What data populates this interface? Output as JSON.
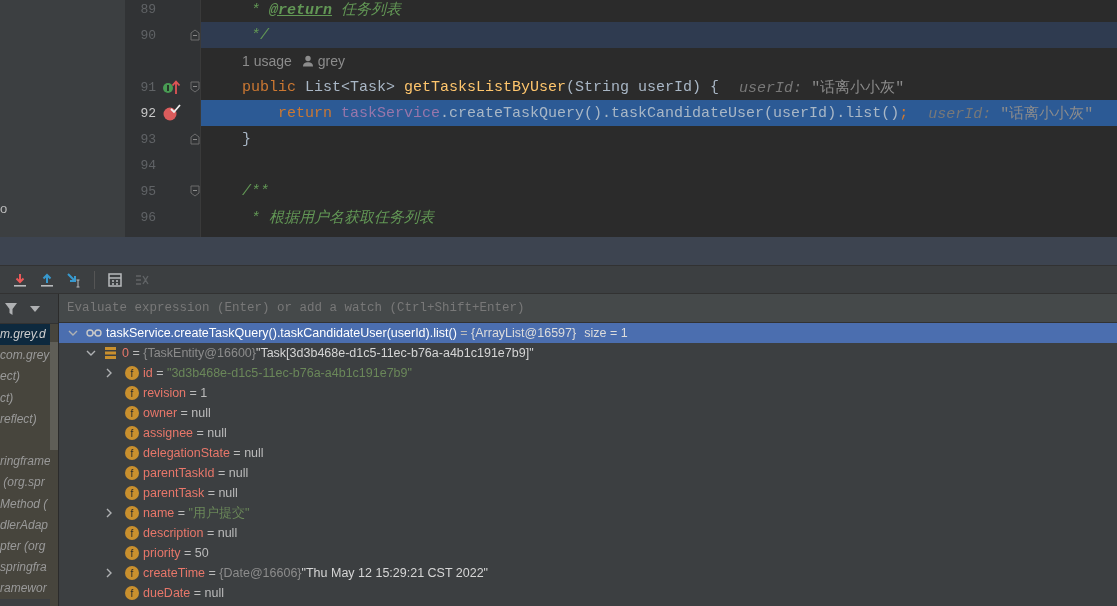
{
  "project_panel": {
    "items": [
      "o"
    ]
  },
  "editor": {
    "lines": [
      {
        "kind": "code",
        "number": "89",
        "tokens": [
          {
            "text": " * ",
            "kind": "comment"
          },
          {
            "text": "@return",
            "kind": "doc_tag"
          },
          {
            "text": " 任务列表",
            "kind": "comment"
          }
        ]
      },
      {
        "kind": "code",
        "number": "90",
        "caret_line": true,
        "fold_end": true,
        "tokens": [
          {
            "text": " */",
            "kind": "comment"
          }
        ]
      },
      {
        "kind": "usage",
        "usages": "1 usage",
        "author": "grey"
      },
      {
        "kind": "code",
        "number": "91",
        "implements_marker": true,
        "fold_start": true,
        "tokens": [
          {
            "text": "public",
            "kind": "keyword"
          },
          {
            "text": " List<Task> ",
            "kind": "plain"
          },
          {
            "text": "getTasksListByUser",
            "kind": "method"
          },
          {
            "text": "(String userId) {",
            "kind": "plain"
          }
        ],
        "hint": {
          "name": "userId:",
          "value": "\"话离小小灰\""
        }
      },
      {
        "kind": "code",
        "number": "92",
        "current": true,
        "execution_point": true,
        "breakpoint": true,
        "tokens": [
          {
            "text": "    return ",
            "kind": "keyword"
          },
          {
            "text": "taskService",
            "kind": "field"
          },
          {
            "text": ".createTaskQuery().taskCandidateUser(userId).list()",
            "kind": "plain"
          },
          {
            "text": ";",
            "kind": "keyword"
          }
        ],
        "hint": {
          "name": "userId:",
          "value": "\"话离小小灰\""
        }
      },
      {
        "kind": "code",
        "number": "93",
        "fold_end": true,
        "tokens": [
          {
            "text": "}",
            "kind": "plain"
          }
        ]
      },
      {
        "kind": "code",
        "number": "94"
      },
      {
        "kind": "code",
        "number": "95",
        "fold_start": true,
        "tokens": [
          {
            "text": "/**",
            "kind": "comment"
          }
        ]
      },
      {
        "kind": "code",
        "number": "96",
        "tokens": [
          {
            "text": " * 根据用户名获取任务列表",
            "kind": "comment"
          }
        ]
      }
    ]
  },
  "debugger": {
    "toolbar": [
      {
        "kind": "step-into"
      },
      {
        "kind": "step-out"
      },
      {
        "kind": "run-to-cursor"
      },
      {
        "kind": "separator"
      },
      {
        "kind": "evaluate"
      },
      {
        "kind": "trace",
        "disabled": true
      }
    ],
    "frames": [
      {
        "label": "m.grey.d",
        "selected": true
      },
      {
        "label": "com.grey",
        "selected": false
      },
      {
        "label": "ect)",
        "selected": false
      },
      {
        "label": "ct)",
        "selected": false
      },
      {
        "label": "reflect)",
        "selected": false
      },
      {
        "selected": false
      },
      {
        "label": "ringframe",
        "selected": false
      },
      {
        "label": " (org.spr",
        "selected": false
      },
      {
        "label": "Method (",
        "selected": false
      },
      {
        "label": "dlerAdap",
        "selected": false
      },
      {
        "label": "pter (org",
        "selected": false
      },
      {
        "label": "springfra",
        "selected": false
      },
      {
        "label": "ramewor",
        "selected": false
      }
    ],
    "evaluate_field": {
      "placeholder": "Evaluate expression (Enter) or add a watch (Ctrl+Shift+Enter)"
    },
    "variables": [
      {
        "kind": "watch",
        "name": "taskService.createTaskQuery().taskCandidateUser(userId).list()",
        "operator": "=",
        "ref": "{ArrayList@16597}",
        "extra": "size = 1",
        "selected": true,
        "expanded": true,
        "children": [
          {
            "kind": "item",
            "name": "0",
            "operator": "=",
            "ref": "{TaskEntity@16600}",
            "value": {
              "text": "\"Task[3d3b468e-d1c5-11ec-b76a-a4b1c191e7b9]\"",
              "kind": "object"
            },
            "selected": false,
            "expanded": true,
            "children": [
              {
                "kind": "field",
                "badge": "f",
                "name": "id",
                "operator": "=",
                "value": {
                  "text": "\"3d3b468e-d1c5-11ec-b76a-a4b1c191e7b9\"",
                  "kind": "string"
                },
                "selected": false,
                "expanded": false
              },
              {
                "kind": "field",
                "badge": "f",
                "name": "revision",
                "operator": "=",
                "value": {
                  "text": "1",
                  "kind": "primitive"
                },
                "selected": false
              },
              {
                "kind": "field",
                "badge": "f",
                "name": "owner",
                "operator": "=",
                "value": {
                  "text": "null",
                  "kind": "primitive"
                },
                "selected": false
              },
              {
                "kind": "field",
                "badge": "f",
                "name": "assignee",
                "operator": "=",
                "value": {
                  "text": "null",
                  "kind": "primitive"
                },
                "selected": false
              },
              {
                "kind": "field",
                "badge": "f",
                "name": "delegationState",
                "operator": "=",
                "value": {
                  "text": "null",
                  "kind": "primitive"
                },
                "selected": false
              },
              {
                "kind": "field",
                "badge": "f",
                "name": "parentTaskId",
                "operator": "=",
                "value": {
                  "text": "null",
                  "kind": "primitive"
                },
                "selected": false
              },
              {
                "kind": "field",
                "badge": "f",
                "name": "parentTask",
                "operator": "=",
                "value": {
                  "text": "null",
                  "kind": "primitive"
                },
                "selected": false
              },
              {
                "kind": "field",
                "badge": "f",
                "name": "name",
                "operator": "=",
                "value": {
                  "text": "\"用户提交\"",
                  "kind": "string"
                },
                "selected": false,
                "expanded": false
              },
              {
                "kind": "field",
                "badge": "f",
                "name": "description",
                "operator": "=",
                "value": {
                  "text": "null",
                  "kind": "primitive"
                },
                "selected": false
              },
              {
                "kind": "field",
                "badge": "f",
                "name": "priority",
                "operator": "=",
                "value": {
                  "text": "50",
                  "kind": "primitive"
                },
                "selected": false
              },
              {
                "kind": "field",
                "badge": "f",
                "name": "createTime",
                "operator": "=",
                "ref": "{Date@16606}",
                "value": {
                  "text": "\"Thu May 12 15:29:21 CST 2022\"",
                  "kind": "object"
                },
                "selected": false,
                "expanded": false
              },
              {
                "kind": "field",
                "badge": "f",
                "name": "dueDate",
                "operator": "=",
                "value": {
                  "text": "null",
                  "kind": "primitive"
                },
                "selected": false
              }
            ]
          }
        ]
      }
    ]
  }
}
